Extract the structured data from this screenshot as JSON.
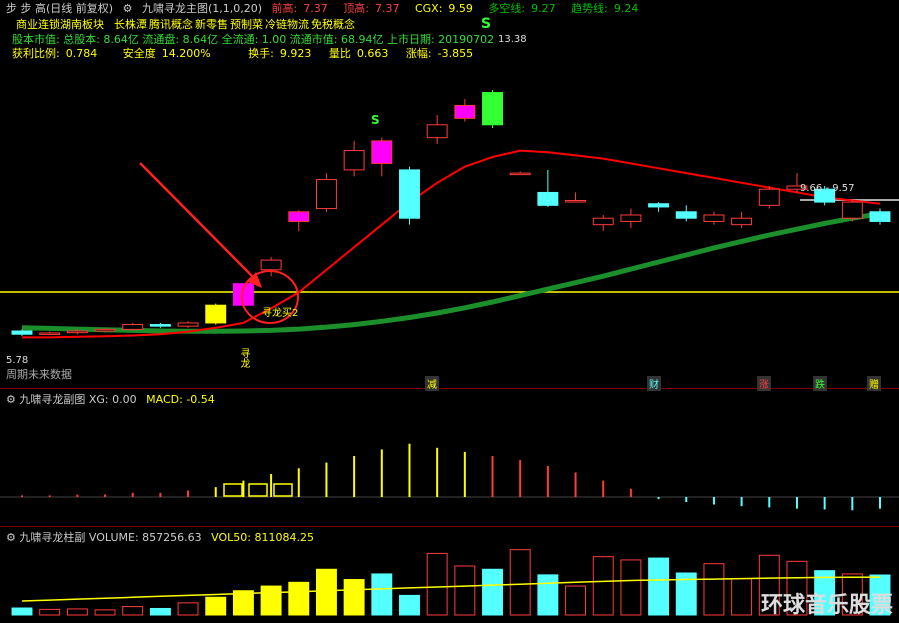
{
  "header": {
    "period_label": "步 步 高(日线 前复权)",
    "indicator_main": "九啸寻龙主图(1,1,0,20)",
    "prev_high_label": "前高:",
    "prev_high_value": "7.37",
    "top_label": "顶高:",
    "top_value": "7.37",
    "cgx_label": "CGX:",
    "cgx_value": "9.59",
    "duokong_label": "多空线:",
    "duokong_value": "9.27",
    "trend_label": "趋势线:",
    "trend_value": "9.24"
  },
  "info": {
    "line1": [
      "商业连锁",
      "湖南板块",
      "长株潭",
      "腾讯概念",
      "新零售",
      "预制菜",
      "冷链物流",
      "免税概念"
    ],
    "line2": "股本市值: 总股本: 8.64亿 流通盘: 8.64亿 全流通: 1.00 流通市值: 68.94亿 上市日期: 20190702",
    "line3_items": [
      {
        "label": "获利比例:",
        "value": "0.784"
      },
      {
        "label": "安全度",
        "value": "14.200%"
      },
      {
        "label": "换手:",
        "value": "9.923"
      },
      {
        "label": "量比",
        "value": "0.663"
      },
      {
        "label": "涨幅:",
        "value": "-3.855"
      }
    ]
  },
  "main_chart": {
    "annotations": {
      "high_price": "13.38",
      "low_price": "5.78",
      "range_label": "9.66 - 9.57",
      "s_mark": "S",
      "signal_label": "寻龙买2",
      "vertical_label": "寻龙",
      "bottom_left": "周期未来数据"
    },
    "event_tags": [
      "减",
      "财",
      "涨",
      "跌",
      "赠"
    ]
  },
  "sub1": {
    "title": "九啸寻龙副图",
    "xg_label": "XG:",
    "xg_value": "0.00",
    "macd_label": "MACD:",
    "macd_value": "-0.54"
  },
  "sub2": {
    "title": "九啸寻龙柱副",
    "vol_label": "VOLUME:",
    "vol_value": "857256.63",
    "vol50_label": "VOL50:",
    "vol50_value": "811084.25"
  },
  "colors": {
    "up": "#ff3b3b",
    "down": "#54ffff",
    "ma_red": "#ff0000",
    "ma_green": "#1b8f2a",
    "yellow": "#ffff00",
    "magenta": "#ff00ff",
    "green_bar": "#33ff33"
  },
  "watermark": "环球音乐股票",
  "chart_data": {
    "type": "candlestick",
    "candles": [
      {
        "o": 5.9,
        "c": 5.8,
        "h": 5.95,
        "l": 5.75
      },
      {
        "o": 5.82,
        "c": 5.84,
        "h": 5.88,
        "l": 5.78
      },
      {
        "o": 5.85,
        "c": 5.9,
        "h": 5.95,
        "l": 5.8
      },
      {
        "o": 5.9,
        "c": 5.95,
        "h": 6.0,
        "l": 5.85
      },
      {
        "o": 5.95,
        "c": 6.1,
        "h": 6.15,
        "l": 5.9
      },
      {
        "o": 6.1,
        "c": 6.05,
        "h": 6.15,
        "l": 6.0
      },
      {
        "o": 6.05,
        "c": 6.15,
        "h": 6.2,
        "l": 6.0
      },
      {
        "o": 6.15,
        "c": 6.7,
        "h": 6.75,
        "l": 6.1
      },
      {
        "o": 6.7,
        "c": 7.37,
        "h": 7.37,
        "l": 6.65
      },
      {
        "o": 7.8,
        "c": 8.1,
        "h": 8.2,
        "l": 7.6
      },
      {
        "o": 9.3,
        "c": 9.6,
        "h": 9.65,
        "l": 9.0
      },
      {
        "o": 9.7,
        "c": 10.6,
        "h": 10.8,
        "l": 9.6
      },
      {
        "o": 10.9,
        "c": 11.5,
        "h": 11.8,
        "l": 10.7
      },
      {
        "o": 11.8,
        "c": 11.1,
        "h": 11.9,
        "l": 10.7
      },
      {
        "o": 10.9,
        "c": 9.4,
        "h": 11.0,
        "l": 9.2
      },
      {
        "o": 11.9,
        "c": 12.3,
        "h": 12.6,
        "l": 11.7
      },
      {
        "o": 12.5,
        "c": 12.9,
        "h": 13.1,
        "l": 12.4
      },
      {
        "o": 13.3,
        "c": 12.3,
        "h": 13.38,
        "l": 12.2
      },
      {
        "o": 10.8,
        "c": 10.8,
        "h": 10.85,
        "l": 10.75
      },
      {
        "o": 10.2,
        "c": 9.8,
        "h": 10.9,
        "l": 9.75
      },
      {
        "o": 9.95,
        "c": 9.95,
        "h": 10.2,
        "l": 9.9
      },
      {
        "o": 9.2,
        "c": 9.4,
        "h": 9.5,
        "l": 9.0
      },
      {
        "o": 9.3,
        "c": 9.5,
        "h": 9.7,
        "l": 9.1
      },
      {
        "o": 9.85,
        "c": 9.75,
        "h": 9.9,
        "l": 9.6
      },
      {
        "o": 9.6,
        "c": 9.4,
        "h": 9.8,
        "l": 9.3
      },
      {
        "o": 9.3,
        "c": 9.5,
        "h": 9.6,
        "l": 9.2
      },
      {
        "o": 9.2,
        "c": 9.4,
        "h": 9.6,
        "l": 9.1
      },
      {
        "o": 9.8,
        "c": 10.3,
        "h": 10.4,
        "l": 9.7
      },
      {
        "o": 10.3,
        "c": 10.4,
        "h": 10.8,
        "l": 10.2
      },
      {
        "o": 10.3,
        "c": 9.9,
        "h": 10.4,
        "l": 9.8
      },
      {
        "o": 9.4,
        "c": 9.9,
        "h": 10.0,
        "l": 9.3
      },
      {
        "o": 9.6,
        "c": 9.3,
        "h": 9.7,
        "l": 9.2
      }
    ],
    "ma_red": [
      5.7,
      5.7,
      5.72,
      5.74,
      5.76,
      5.8,
      5.88,
      6.0,
      6.15,
      6.6,
      7.1,
      7.8,
      8.5,
      9.2,
      9.9,
      10.5,
      11.0,
      11.3,
      11.5,
      11.45,
      11.35,
      11.25,
      11.1,
      10.95,
      10.8,
      10.65,
      10.5,
      10.35,
      10.2,
      10.05,
      9.95,
      9.85
    ],
    "ma_green": [
      6.0,
      5.98,
      5.96,
      5.94,
      5.92,
      5.9,
      5.89,
      5.89,
      5.9,
      5.92,
      5.96,
      6.02,
      6.1,
      6.2,
      6.32,
      6.46,
      6.62,
      6.8,
      7.0,
      7.2,
      7.4,
      7.6,
      7.82,
      8.04,
      8.26,
      8.48,
      8.68,
      8.88,
      9.06,
      9.24,
      9.4,
      9.54
    ],
    "macd": [
      0.02,
      0.02,
      0.03,
      0.03,
      0.05,
      0.05,
      0.08,
      0.12,
      0.2,
      0.28,
      0.35,
      0.42,
      0.5,
      0.58,
      0.65,
      0.6,
      0.55,
      0.5,
      0.45,
      0.38,
      0.3,
      0.2,
      0.1,
      -0.05,
      -0.12,
      -0.18,
      -0.22,
      -0.25,
      -0.28,
      -0.3,
      -0.32,
      -0.28
    ],
    "volume": [
      150000,
      120000,
      130000,
      110000,
      180000,
      140000,
      260000,
      380000,
      520000,
      620000,
      700000,
      980000,
      760000,
      880000,
      420000,
      1320000,
      1050000,
      980000,
      1400000,
      860000,
      620000,
      1250000,
      1180000,
      1220000,
      900000,
      1100000,
      780000,
      1280000,
      1150000,
      950000,
      880000,
      857256.63
    ],
    "vol50": [
      300000,
      320000,
      340000,
      360000,
      380000,
      400000,
      420000,
      440000,
      460000,
      480000,
      500000,
      520000,
      540000,
      560000,
      580000,
      600000,
      620000,
      640000,
      660000,
      680000,
      700000,
      720000,
      740000,
      750000,
      760000,
      770000,
      780000,
      790000,
      800000,
      805000,
      808000,
      811084.25
    ],
    "ylim_main": [
      5.0,
      14.0
    ],
    "ylim_macd": [
      -0.6,
      1.0
    ],
    "ylim_volume": [
      0,
      1500000
    ],
    "title": "九啸寻龙主图",
    "xlabel": "",
    "ylabel": ""
  }
}
